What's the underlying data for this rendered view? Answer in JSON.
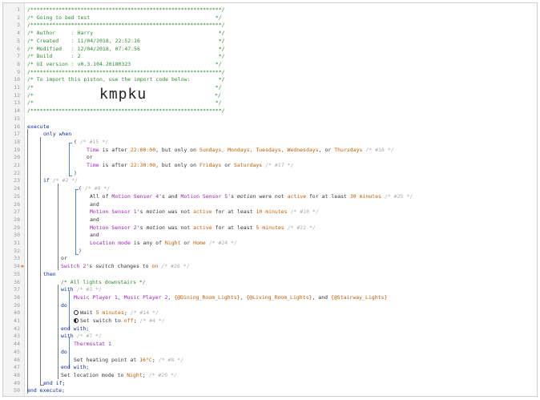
{
  "header": {
    "stars": "/*************************************************************/",
    "title": "/* Going to bed test                                        */",
    "author": "/* Author     : Harry                                        */",
    "created": "/* Created    : 11/04/2018, 22:52:16                         */",
    "modified": "/* Modified   : 12/04/2018, 07:47:56                         */",
    "build": "/* Build      : 2                                            */",
    "ui_version": "/* UI version : v0.3.104.20180323                           */",
    "import_note": "/* To import this piston, use the import code below:         */",
    "blank_comment": "/*                                                          */",
    "import_code": "kmpku",
    "import_code_left": "/*",
    "import_code_right": "*/"
  },
  "line_numbers": [
    "1",
    "2",
    "3",
    "4",
    "5",
    "6",
    "7",
    "8",
    "9",
    "10",
    "11",
    "12",
    "13",
    "14",
    "15",
    "16",
    "17",
    "18",
    "19",
    "20",
    "21",
    "22",
    "23",
    "24",
    "25",
    "26",
    "27",
    "28",
    "29",
    "30",
    "31",
    "32",
    "33",
    "34",
    "35",
    "36",
    "37",
    "38",
    "39",
    "40",
    "41",
    "42",
    "43",
    "44",
    "45",
    "46",
    "47",
    "48",
    "49",
    "50"
  ],
  "code": {
    "execute": "execute",
    "only_when": "only when",
    "open_paren": "(",
    "close_paren": ")",
    "c15": "/* #15 */",
    "t1_time_is_after": "Time",
    "t1_rest": " is after ",
    "t1_time": "22:00:00",
    "t1_but": ", but only on ",
    "t1_days": "Sundays, Mondays, Tuesdays, Wednesdays",
    "t1_or": ", or ",
    "t1_thu": "Thursdays",
    "c16": "/* #16 */",
    "or": "or",
    "t2_time_is_after": "Time",
    "t2_rest": " is after ",
    "t2_time": "22:30:00",
    "t2_but": ", but only on ",
    "t2_fri": "Fridays",
    "t2_or": " or ",
    "t2_sat": "Saturdays",
    "c17": "/* #17 */",
    "if": "if",
    "c2": "/* #2 */",
    "c9": "/* #9 */",
    "l25_a": "All of ",
    "l25_ms4": "Motion Sensor 4",
    "l25_and": "'s and ",
    "l25_ms5": "Motion Sensor 5",
    "l25_s": "'s ",
    "l25_motion": "motion",
    "l25_were": " were not ",
    "l25_active": "active",
    "l25_for": " for at least ",
    "l25_30": "30 minutes",
    "c25": "/* #25 */",
    "and": "and",
    "l27_ms1": "Motion Sensor 1",
    "l27_s": "'s ",
    "l27_motion": "motion",
    "l27_was": " was not ",
    "l27_active": "active",
    "l27_for": " for at least ",
    "l27_10": "10 minutes",
    "c10": "/* #10 */",
    "l29_ms2": "Motion Sensor 2",
    "l29_s": "'s ",
    "l29_motion": "motion",
    "l29_was": " was not ",
    "l29_active": "active",
    "l29_for": " for at least ",
    "l29_5": "5 minutes",
    "c22": "/* #22 */",
    "l31_loc": "Location mode",
    "l31_is": " is any of ",
    "l31_night": "Night",
    "l31_or": " or ",
    "l31_home": "Home",
    "c24": "/* #24 */",
    "l34_sw": "Switch 2",
    "l34_s": "'s ",
    "l34_switch": "switch",
    "l34_changes": " changes to ",
    "l34_on": "on",
    "c26": "/* #26 */",
    "then": "then",
    "l37_comment": "/* All lights downstairs */",
    "with": "with",
    "c3": "/* #3 */",
    "l39_mp1": "Music Player 1",
    "l39_comma1": ", ",
    "l39_mp2": "Music Player 2",
    "l39_comma2": ", ",
    "l39_g1": "{@Dining_Room_Lights}",
    "l39_comma3": ", ",
    "l39_g2": "{@Living_Room_Lights}",
    "l39_and": ", and ",
    "l39_g3": "{@Stairway_Lights}",
    "do": "do",
    "l41_wait": "Wait ",
    "l41_5": "5 minutes",
    "l41_semi": ";",
    "c14": "/* #14 */",
    "l42_set": "Set switch to ",
    "l42_off": "off",
    "l42_semi": ";",
    "c4": "/* #4 */",
    "end_with": "end with;",
    "c7": "/* #7 */",
    "l44_thermo": "Thermostat 1",
    "l46_set": "Set heating point at ",
    "l46_temp": "16°C",
    "l46_semi": ";",
    "c8": "/* #8 */",
    "l48_set": "Set location mode to ",
    "l48_night": "Night",
    "l48_semi": ";",
    "c20": "/* #20 */",
    "end_if": "end if;",
    "end_execute": "end execute;"
  }
}
